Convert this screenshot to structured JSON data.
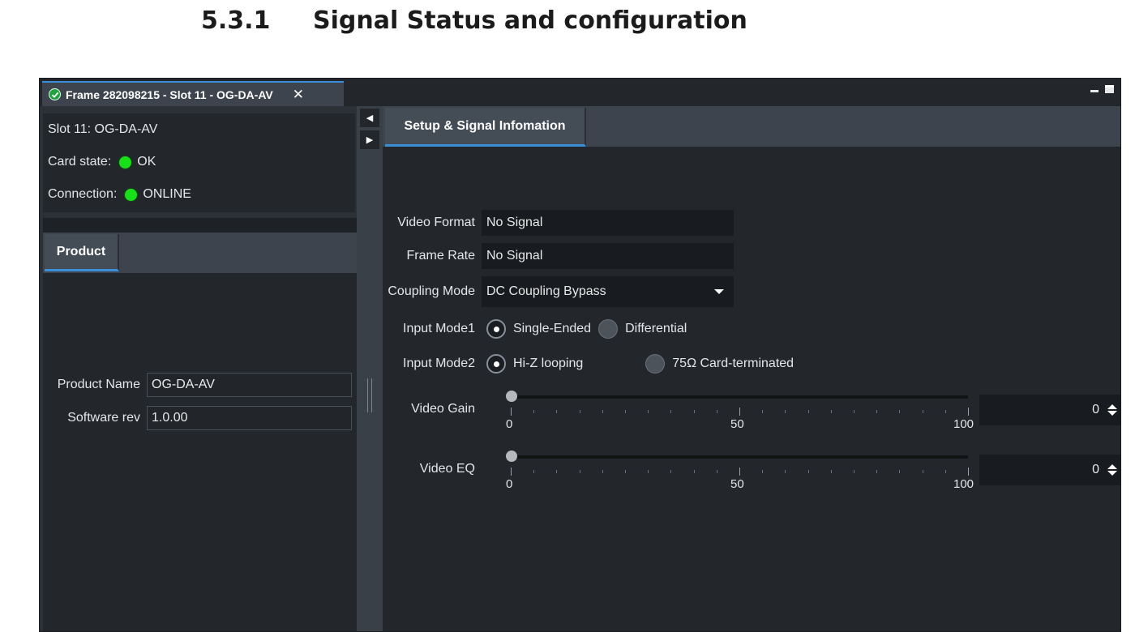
{
  "doc": {
    "section_number": "5.3.1",
    "section_title": "Signal Status and configuration"
  },
  "window": {
    "tab_title": "Frame 282098215 - Slot 11 - OG-DA-AV",
    "close_glyph": "✕",
    "icons": [
      "check-circle-icon",
      "close-icon",
      "minimize-icon",
      "maximize-icon"
    ]
  },
  "card": {
    "slot_label": "Slot 11: OG-DA-AV",
    "state_label": "Card state:",
    "state_value": "OK",
    "connection_label": "Connection:",
    "connection_value": "ONLINE",
    "led_color": "#16e016"
  },
  "product": {
    "tab_label": "Product",
    "name_label": "Product Name",
    "name_value": "OG-DA-AV",
    "software_label": "Software rev",
    "software_value": "1.0.00"
  },
  "splitter": {
    "left_arrow": "◀",
    "right_arrow": "▶"
  },
  "setup": {
    "tab_label": "Setup & Signal Infomation",
    "video_format_label": "Video Format",
    "video_format_value": "No Signal",
    "frame_rate_label": "Frame Rate",
    "frame_rate_value": "No Signal",
    "coupling_label": "Coupling Mode",
    "coupling_value": "DC Coupling Bypass",
    "input_mode1_label": "Input Mode1",
    "input_mode1_options": [
      "Single-Ended",
      "Differential"
    ],
    "input_mode1_selected": "Single-Ended",
    "input_mode2_label": "Input Mode2",
    "input_mode2_options": [
      "Hi-Z looping",
      "75Ω Card-terminated"
    ],
    "input_mode2_selected": "Hi-Z looping",
    "video_gain": {
      "label": "Video Gain",
      "min": "0",
      "mid": "50",
      "max": "100",
      "value": "0"
    },
    "video_eq": {
      "label": "Video EQ",
      "min": "0",
      "mid": "50",
      "max": "100",
      "value": "0"
    }
  },
  "colors": {
    "accent": "#3b8ed8",
    "panel": "#23272c",
    "status_ok": "#16e016"
  }
}
